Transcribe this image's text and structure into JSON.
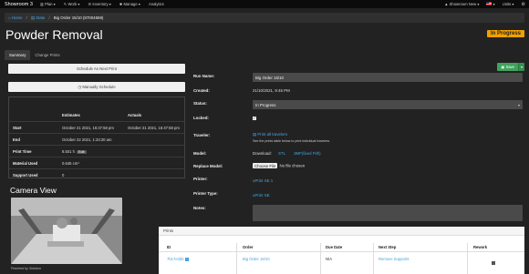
{
  "nav": {
    "brand": "Showroom 3",
    "items": [
      {
        "label": "Plan",
        "icon": "chart-icon"
      },
      {
        "label": "Work",
        "icon": "wrench-icon"
      },
      {
        "label": "Inventory",
        "icon": "list-icon"
      },
      {
        "label": "Manage",
        "icon": "gear-icon"
      },
      {
        "label": "Analytics",
        "icon": ""
      }
    ],
    "user": "Showroom New",
    "units": "Units"
  },
  "breadcrumb": {
    "home": "Home",
    "state": "State",
    "current": "Big Order 15/10 (87004659)"
  },
  "page": {
    "title": "Powder Removal",
    "status": "In Progress",
    "status_color": "#f0a000"
  },
  "tabs": [
    {
      "label": "Summary",
      "active": true
    },
    {
      "label": "Change Prints",
      "active": false
    }
  ],
  "buttons": {
    "schedule_next": "Schedule As Next Print",
    "manual_schedule": "Manually Schedule",
    "save": "Save"
  },
  "estimates_table": {
    "headers": [
      "",
      "Estimates",
      "Actuals"
    ],
    "rows": [
      {
        "label": "Start",
        "estimate": "October 21 2021, 16:47:58 pm",
        "actual": "October 21 2021, 16:47:58 pm"
      },
      {
        "label": "End",
        "estimate": "October 22 2021, 1:33:20 am",
        "actual": ""
      },
      {
        "label": "Print Time",
        "estimate": "8.501 h",
        "badge": "Edit",
        "actual": ""
      },
      {
        "label": "Material Used",
        "estimate": "0.645 cm³",
        "actual": ""
      },
      {
        "label": "Support Used",
        "estimate": "0",
        "actual": ""
      }
    ]
  },
  "camera": {
    "heading": "Camera View",
    "powered_by": "Powered by Solution"
  },
  "form": {
    "run_name_label": "Run Name:",
    "run_name_value": "Big Order 15/10",
    "created_label": "Created:",
    "created_value": "21/10/2021, 9:45 PM",
    "status_label": "Status:",
    "status_value": "In Progress",
    "locked_label": "Locked:",
    "traveler_label": "Traveler:",
    "traveler_link": "Print all travelers",
    "traveler_note": "See the prints table below to print individual travelers.",
    "model_label": "Model:",
    "model_download": "Download:",
    "model_stl": "STL",
    "model_fixed": "3MF(fixed Fith)",
    "replace_label": "Replace Model:",
    "file_button": "Choose File",
    "file_none": "No file chosen",
    "printer_label": "Printer:",
    "printer_value": "uPrint SE 1",
    "printer_type_label": "Printer Type:",
    "printer_type_value": "uPrint SE",
    "notes_label": "Notes:"
  },
  "prints": {
    "heading": "Prints",
    "columns": [
      "ID",
      "Order",
      "Due Date",
      "Next Step",
      "Rework"
    ],
    "rows": [
      {
        "id": "7b17e2bb",
        "order": "Big Order 15/10",
        "due": "N/A",
        "next": "Remove Supports"
      }
    ]
  }
}
